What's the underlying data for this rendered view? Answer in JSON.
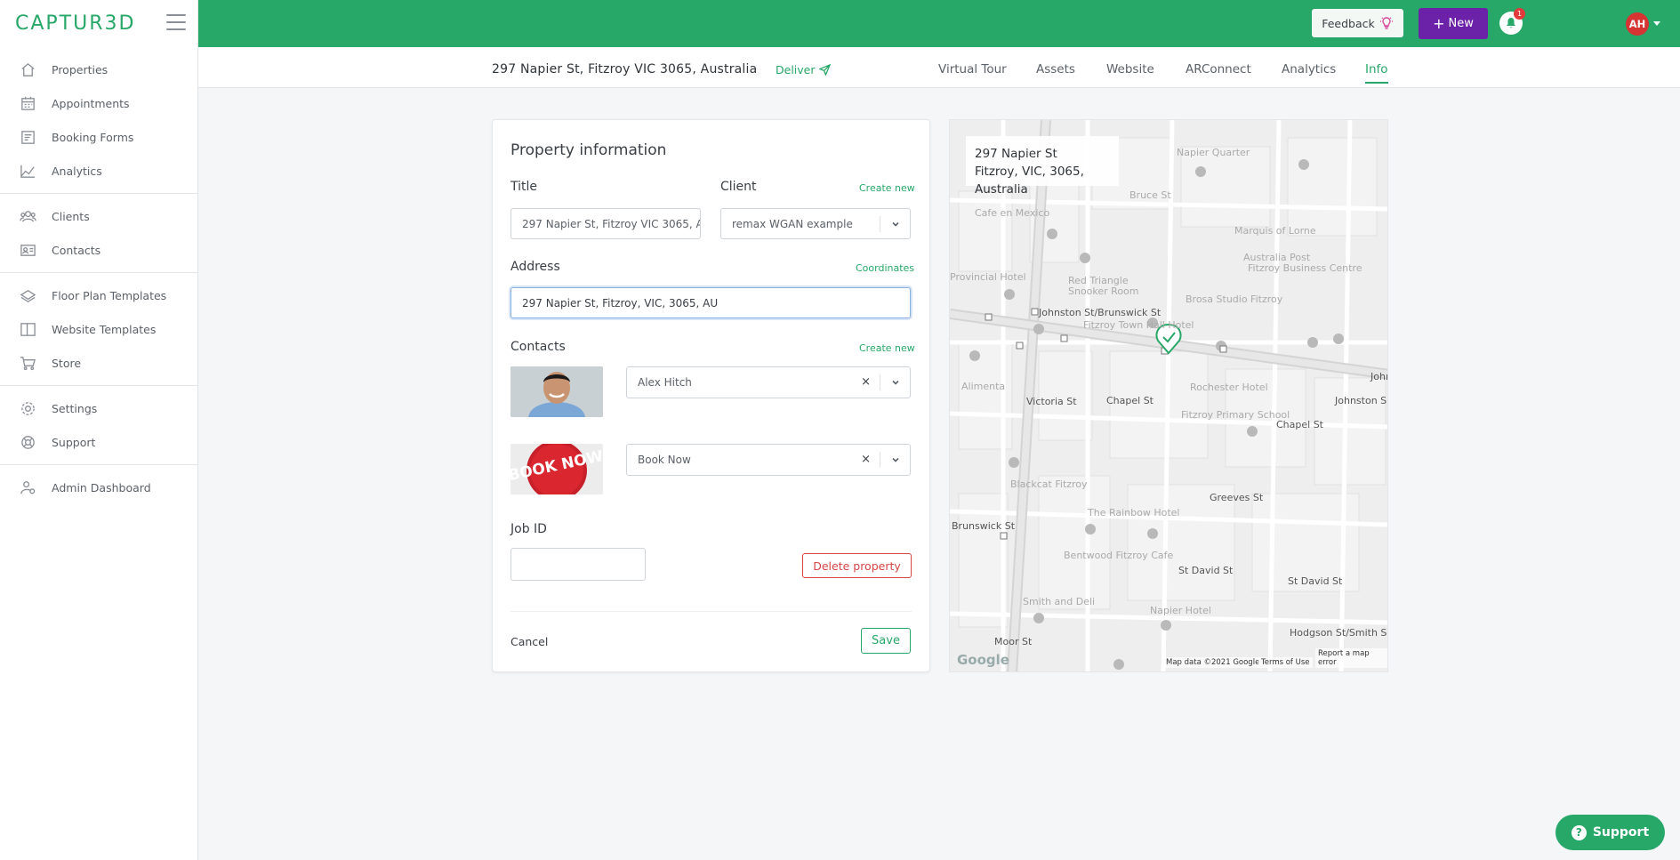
{
  "app": {
    "logo": "CAPTUR3D"
  },
  "sidebar": {
    "groups": [
      [
        {
          "label": "Properties",
          "icon": "home-icon"
        },
        {
          "label": "Appointments",
          "icon": "calendar-icon"
        },
        {
          "label": "Booking Forms",
          "icon": "form-icon"
        },
        {
          "label": "Analytics",
          "icon": "chart-icon"
        }
      ],
      [
        {
          "label": "Clients",
          "icon": "users-icon"
        },
        {
          "label": "Contacts",
          "icon": "contact-card-icon"
        }
      ],
      [
        {
          "label": "Floor Plan Templates",
          "icon": "layers-icon"
        },
        {
          "label": "Website Templates",
          "icon": "columns-icon"
        },
        {
          "label": "Store",
          "icon": "cart-icon"
        }
      ],
      [
        {
          "label": "Settings",
          "icon": "gear-icon"
        },
        {
          "label": "Support",
          "icon": "lifebuoy-icon"
        }
      ],
      [
        {
          "label": "Admin Dashboard",
          "icon": "admin-user-icon"
        }
      ]
    ]
  },
  "topbar": {
    "feedback_label": "Feedback",
    "new_label": "New",
    "notification_count": "1",
    "avatar_initials": "AH"
  },
  "subheader": {
    "address": "297 Napier St, Fitzroy VIC 3065, Australia",
    "deliver_label": "Deliver",
    "tabs": [
      "Virtual Tour",
      "Assets",
      "Website",
      "ARConnect",
      "Analytics",
      "Info"
    ],
    "active_tab": "Info"
  },
  "form": {
    "heading": "Property information",
    "title_label": "Title",
    "title_value": "297 Napier St, Fitzroy VIC 3065, A",
    "client_label": "Client",
    "client_create": "Create new",
    "client_value": "remax WGAN example",
    "address_label": "Address",
    "coordinates_label": "Coordinates",
    "address_value": "297 Napier St, Fitzroy, VIC, 3065, AU",
    "contacts_label": "Contacts",
    "contacts_create": "Create new",
    "contacts": [
      {
        "name": "Alex Hitch"
      },
      {
        "name": "Book Now",
        "image_text": "BOOK NOW"
      }
    ],
    "remove_symbol": "×",
    "job_id_label": "Job ID",
    "job_id_value": "",
    "delete_label": "Delete property",
    "cancel_label": "Cancel",
    "save_label": "Save"
  },
  "map": {
    "info_line1": "297 Napier St",
    "info_line2": "Fitzroy, VIC, 3065, Australia",
    "google": "Google",
    "footer_data": "Map data ©2021 Google",
    "footer_terms": "Terms of Use",
    "footer_report": "Report a map error",
    "labels": {
      "l1": "Napier Quarter",
      "l2": "Marquis of Lorne",
      "l3": "Australia Post",
      "l4": "Fitzroy Business Centre",
      "l5": "Red Triangle",
      "l6": "Snooker Room",
      "l7": "Provincial Hotel",
      "l8": "Johnston St/Brunswick St",
      "l9": "Fitzroy Town Hall Hotel",
      "l10": "Rochester Hotel",
      "l11": "Johnsto",
      "l12": "Johnston S",
      "l13": "Victoria St",
      "l14": "Chapel St",
      "l15": "Fitzroy Primary School",
      "l16": "Chapel St",
      "l17": "Greeves St",
      "l18": "The Rainbow Hotel",
      "l19": "Brunswick St",
      "l20": "Bentwood Fitzroy Cafe",
      "l21": "St David St",
      "l22": "St David St",
      "l23": "Smith and Deli",
      "l24": "Napier Hotel",
      "l25": "Hodgson St/Smith S",
      "l26": "Moor St",
      "l27": "Alimenta",
      "l28": "Blackcat Fitzroy",
      "l29": "Cafe en Mexico",
      "l30": "Bruce St",
      "l31": "Brosa Studio Fitzroy"
    }
  },
  "support_label": "Support",
  "colors": {
    "brand": "#27a768",
    "new_button": "#6b21a8",
    "danger": "#d64545"
  }
}
